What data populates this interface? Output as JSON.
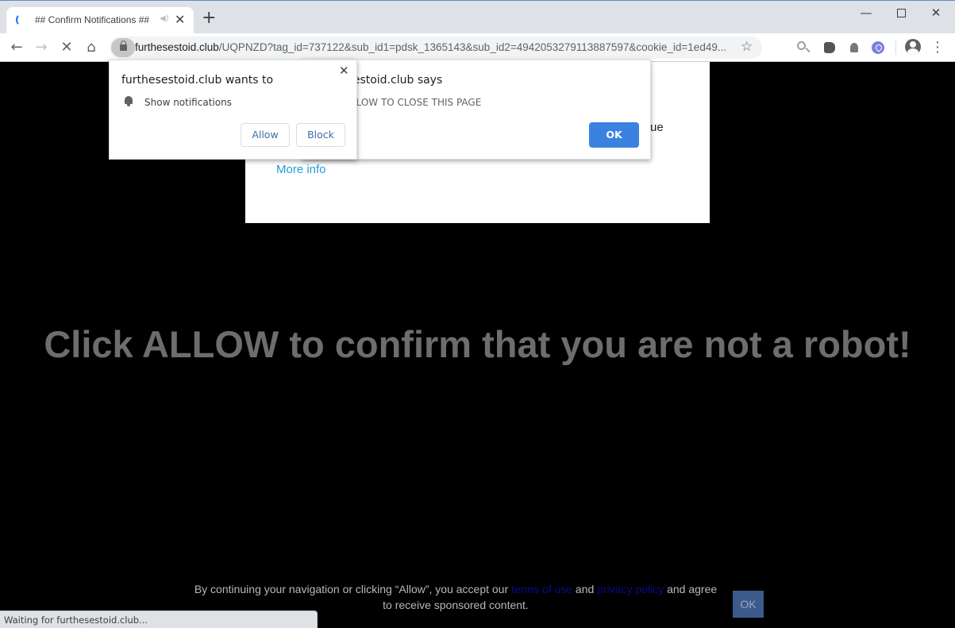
{
  "browser": {
    "tab": {
      "title": "## Confirm Notifications ##",
      "favicon": "loading-spinner-icon",
      "audio_icon": "speaker-muted-icon"
    },
    "new_tab_label": "+",
    "window_controls": {
      "minimize": "—",
      "maximize": "□",
      "close": "✕"
    },
    "toolbar": {
      "back": "←",
      "forward": "→",
      "stop": "✕",
      "home": "⌂",
      "url_host": "furthesestoid.club",
      "url_path": "/UQPNZD?tag_id=737122&sub_id1=pdsk_1365143&sub_id2=4942053279113887597&cookie_id=1ed49...",
      "bookmark": "☆",
      "extensions": [
        "zoom-out-icon",
        "extension-icon",
        "extension-icon",
        "location-pin-extension-icon"
      ],
      "menu": "⋮"
    },
    "status": "Waiting for furthesestoid.club..."
  },
  "permission_prompt": {
    "title": "furthesestoid.club wants to",
    "permission": "Show notifications",
    "close": "✕",
    "allow_label": "Allow",
    "block_label": "Block"
  },
  "alert_dialog": {
    "title": "furthesestoid.club says",
    "message": "CLICK ALLOW TO CLOSE THIS PAGE",
    "ok_label": "OK"
  },
  "page": {
    "card_partial_text": "ue",
    "more_info": "More info",
    "headline": "Click ALLOW to confirm that you are not a robot!",
    "consent": {
      "before": "By continuing your navigation or clicking “Allow”, you accept our ",
      "terms_link": "terms of use",
      "middle": " and ",
      "privacy_link": "privacy policy",
      "after": " and agree to receive sponsored content.",
      "ok_label": "OK"
    }
  }
}
